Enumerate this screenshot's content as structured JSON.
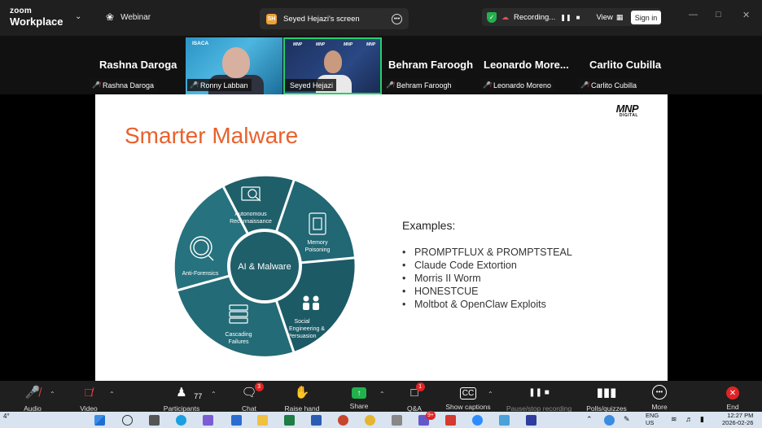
{
  "app": {
    "brand_top": "zoom",
    "brand_bottom": "Workplace",
    "webinar_label": "Webinar",
    "screen_avatar": "SH",
    "screen_tab_label": "Seyed Hejazi's screen",
    "recording_label": "Recording...",
    "view_label": "View",
    "sign_in_label": "Sign in"
  },
  "participants": {
    "big_names": [
      "Rashna Daroga",
      "Behram Faroogh",
      "Leonardo  More...",
      "Carlito Cubilla"
    ],
    "small_names": [
      "Rashna Daroga",
      "Ronny Labban",
      "Seyed Hejazi",
      "Behram Faroogh",
      "Leonardo Moreno",
      "Carlito Cubilla"
    ],
    "isaca_label": "ISACA"
  },
  "slide": {
    "logo": "MNP",
    "logo_sub": "DIGITAL",
    "title": "Smarter Malware",
    "center_label": "AI & Malware",
    "segments": [
      {
        "l1": "Autonomous",
        "l2": "Reconnaissance",
        "l3": ""
      },
      {
        "l1": "Memory",
        "l2": "Poisoning",
        "l3": ""
      },
      {
        "l1": "Social",
        "l2": "Engineering &",
        "l3": "Persuasion"
      },
      {
        "l1": "Cascading",
        "l2": "Failures",
        "l3": ""
      },
      {
        "l1": "Anti-Forensics",
        "l2": "",
        "l3": ""
      }
    ],
    "examples_heading": "Examples:",
    "examples": [
      "PROMPTFLUX & PROMPTSTEAL",
      "Claude Code Extortion",
      "Morris II Worm",
      "HONESTCUE",
      "Moltbot & OpenClaw Exploits"
    ]
  },
  "toolbar": {
    "audio": "Audio",
    "video": "Video",
    "participants": "Participants",
    "participants_count": "77",
    "chat": "Chat",
    "chat_badge": "3",
    "raise_hand": "Raise hand",
    "share": "Share",
    "qa": "Q&A",
    "qa_badge": "1",
    "captions": "Show captions",
    "recording": "Pause/stop recording",
    "polls": "Polls/quizzes",
    "more": "More",
    "end": "End"
  },
  "taskbar": {
    "lang": "ENG",
    "region": "US",
    "time": "12:27 PM",
    "date": "2026-02-26",
    "notif_badge": "9+",
    "temp": "4°"
  },
  "colors": {
    "title_orange": "#e8612c",
    "wheel_teal": "#1f5f6a",
    "speaker_border": "#24d06a",
    "share_green": "#22b14c",
    "end_red": "#e02424"
  }
}
